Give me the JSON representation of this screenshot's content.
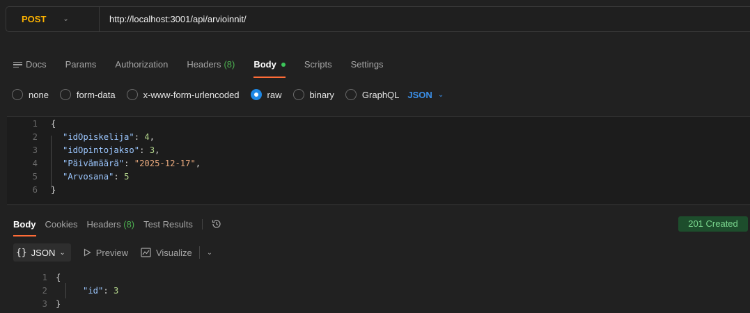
{
  "request": {
    "method": "POST",
    "url": "http://localhost:3001/api/arvioinnit/"
  },
  "request_tabs": [
    {
      "label": "Docs"
    },
    {
      "label": "Params"
    },
    {
      "label": "Authorization"
    },
    {
      "label": "Headers",
      "count": "(8)"
    },
    {
      "label": "Body",
      "active": true
    },
    {
      "label": "Scripts"
    },
    {
      "label": "Settings"
    }
  ],
  "body_options": {
    "items": [
      "none",
      "form-data",
      "x-www-form-urlencoded",
      "raw",
      "binary",
      "GraphQL"
    ],
    "selected": "raw",
    "language": "JSON"
  },
  "request_body": {
    "line_numbers": [
      "1",
      "2",
      "3",
      "4",
      "5",
      "6"
    ],
    "open_brace": "{",
    "close_brace": "}",
    "fields": [
      {
        "key": "\"idOpiskelija\"",
        "value": "4",
        "type": "number",
        "comma": ","
      },
      {
        "key": "\"idOpintojakso\"",
        "value": "3",
        "type": "number",
        "comma": ","
      },
      {
        "key": "\"Päivämäärä\"",
        "value": "\"2025-12-17\"",
        "type": "string",
        "comma": ","
      },
      {
        "key": "\"Arvosana\"",
        "value": "5",
        "type": "number",
        "comma": ""
      }
    ]
  },
  "response_tabs": [
    {
      "label": "Body",
      "active": true
    },
    {
      "label": "Cookies"
    },
    {
      "label": "Headers",
      "count": "(8)"
    },
    {
      "label": "Test Results"
    }
  ],
  "response_status": "201 Created",
  "response_toolbar": {
    "format": "JSON",
    "braces": "{}",
    "preview": "Preview",
    "visualize": "Visualize"
  },
  "response_body": {
    "line_numbers": [
      "1",
      "2",
      "3"
    ],
    "open_brace": "{",
    "close_brace": "}",
    "key": "\"id\"",
    "value": "3"
  },
  "colors": {
    "method": "#ffb400",
    "active_tab_underline": "#ff6c37",
    "selected_radio": "#1e88e5",
    "status_bg": "#1d4d2c",
    "status_text": "#7bd88f",
    "json_key": "#9cc7ff",
    "json_number": "#b6d98e",
    "json_string": "#e8a87c"
  }
}
